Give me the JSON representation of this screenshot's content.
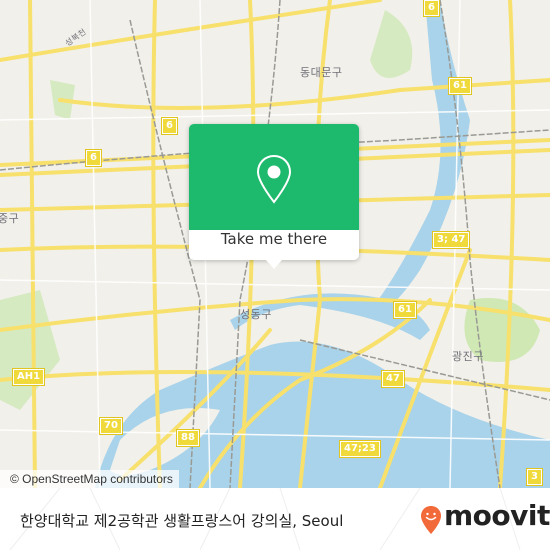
{
  "map": {
    "district_labels": [
      {
        "id": "dongdaemun",
        "text": "동대문구"
      },
      {
        "id": "seongdong",
        "text": "성동구"
      },
      {
        "id": "gwangjin",
        "text": "광진구"
      },
      {
        "id": "junggu",
        "text": "중구"
      },
      {
        "id": "stream",
        "text": "성북천"
      }
    ],
    "route_shields": [
      "6",
      "6",
      "6",
      "61",
      "3; 47",
      "61",
      "47",
      "47;23",
      "88",
      "70",
      "AH1",
      "3"
    ],
    "water_color": "#a9d3ea",
    "road_color": "#f7e06b",
    "park_color": "#cfe8b4"
  },
  "attribution": "© OpenStreetMap contributors",
  "popup": {
    "icon": "location-pin-icon",
    "button_label": "Take me there",
    "accent_color": "#1db96c"
  },
  "footer": {
    "place_title": "한양대학교 제2공학관 생활프랑스어 강의실, Seoul",
    "brand": "moovit",
    "brand_color": "#f26a3a"
  }
}
